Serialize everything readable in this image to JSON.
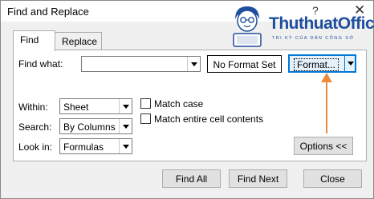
{
  "window": {
    "title": "Find and Replace",
    "help_glyph": "?",
    "close_glyph": "✕"
  },
  "watermark": {
    "brand": "ThuthuatOffice",
    "tagline": "TRI KỲ CỦA DÂN CÔNG SỞ"
  },
  "tabs": [
    {
      "label": "Find",
      "active": true
    },
    {
      "label": "Replace",
      "active": false
    }
  ],
  "find": {
    "label": "Find what:",
    "value": "",
    "format_preview": "No Format Set",
    "format_button": "Format..."
  },
  "options": {
    "within": {
      "label": "Within:",
      "value": "Sheet"
    },
    "search": {
      "label": "Search:",
      "value": "By Columns"
    },
    "look_in": {
      "label": "Look in:",
      "value": "Formulas"
    },
    "match_case": {
      "label": "Match case",
      "checked": false
    },
    "match_entire": {
      "label": "Match entire cell contents",
      "checked": false
    },
    "options_button": "Options <<"
  },
  "buttons": {
    "find_all": "Find All",
    "find_next": "Find Next",
    "close": "Close"
  },
  "colors": {
    "accent": "#0078d7",
    "annotation_arrow": "#f08a3b",
    "brand": "#1f4e9e"
  }
}
